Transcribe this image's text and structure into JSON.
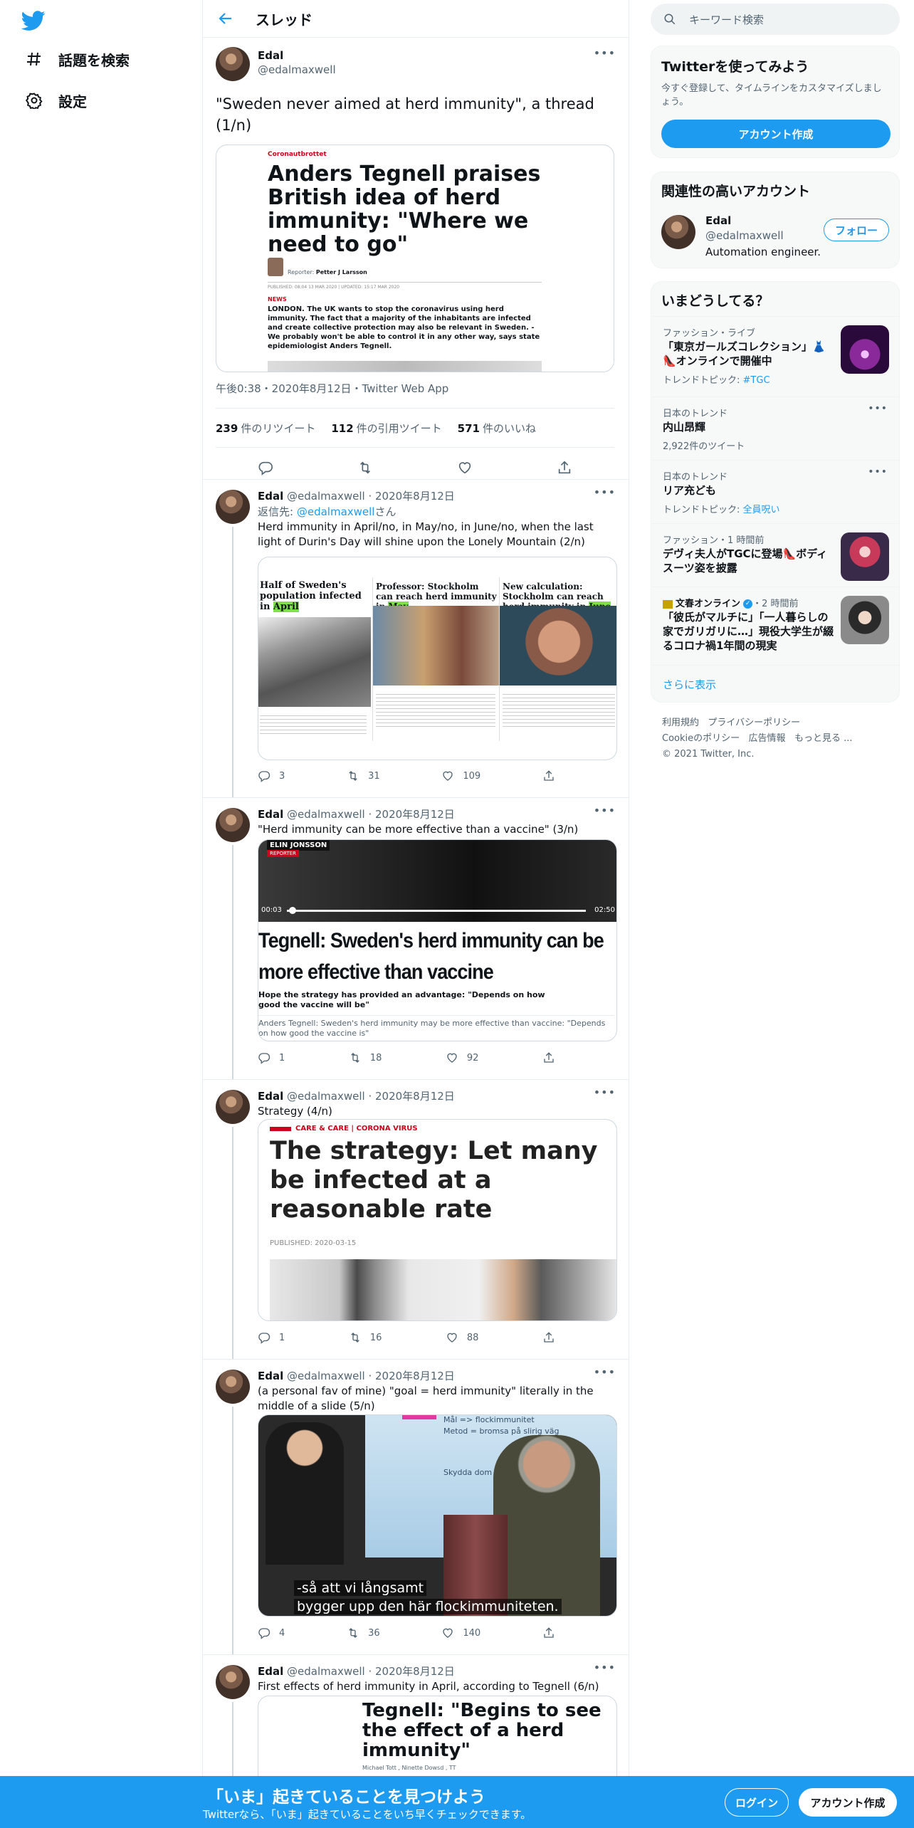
{
  "nav": {
    "explore_label": "話題を検索",
    "settings_label": "設定"
  },
  "header": {
    "title": "スレッド"
  },
  "main_tweet": {
    "name": "Edal",
    "handle": "@edalmaxwell",
    "text": "\"Sweden never aimed at herd immunity\", a thread (1/n)",
    "meta": "午後0:38・2020年8月12日・Twitter Web App",
    "retweets": "239",
    "retweets_label": "件のリツイート",
    "quotes": "112",
    "quotes_label": "件の引用ツイート",
    "likes": "571",
    "likes_label": "件のいいね",
    "card": {
      "kicker": "Coronautbrottet",
      "headline": "Anders Tegnell praises British idea of herd immunity: \"Where we need to go\"",
      "reporter_label": "Reporter:",
      "reporter": "Petter J Larsson",
      "published": "PUBLISHED: 08:04 13 MAR 2020 | UPDATED: 15:17 MAR 2020",
      "news_label": "NEWS",
      "body": "LONDON. The UK wants to stop the coronavirus using herd immunity. The fact that a majority of the inhabitants are infected and create collective protection may also be relevant in Sweden. - We probably won't be able to control it in any other way, says state epidemiologist Anders Tegnell."
    }
  },
  "tweets": [
    {
      "name": "Edal",
      "handle": "@edalmaxwell",
      "date": "2020年8月12日",
      "reply_prefix": "返信先:",
      "reply_to": "@edalmaxwell",
      "reply_suffix": "さん",
      "text": "Herd immunity in April/no, in May/no, in June/no,  when the last light of Durin's Day will shine upon the Lonely Mountain (2/n)",
      "replies": "3",
      "retweets": "31",
      "likes": "109",
      "panel1_title": "Half of Sweden's population infected in",
      "panel1_highlight": "April",
      "panel2_title": "Professor: Stockholm can reach herd immunity in",
      "panel2_highlight": "May",
      "panel3_title": "New calculation: Stockholm can reach herd immunity in",
      "panel3_highlight": "June"
    },
    {
      "name": "Edal",
      "handle": "@edalmaxwell",
      "date": "2020年8月12日",
      "text": "\"Herd immunity can be more effective than a vaccine\" (3/n)",
      "replies": "1",
      "retweets": "18",
      "likes": "92",
      "video_name": "ELIN JONSSON",
      "video_role": "REPORTER",
      "video_time_start": "00:03",
      "video_time_end": "02:50",
      "video_progress": 0.02,
      "headline": "Tegnell: Sweden's herd immunity can be more effective than vaccine",
      "sub": "Hope the strategy has provided an advantage: \"Depends on how good the vaccine will be\"",
      "caption": "Anders Tegnell: Sweden's herd immunity may be more effective than vaccine: \"Depends on how good the vaccine is\""
    },
    {
      "name": "Edal",
      "handle": "@edalmaxwell",
      "date": "2020年8月12日",
      "text": "Strategy  (4/n)",
      "replies": "1",
      "retweets": "16",
      "likes": "88",
      "kicker": "CARE & CARE | CORONA VIRUS",
      "headline": "The strategy: Let many be infected at a reasonable rate",
      "published": "PUBLISHED: 2020-03-15"
    },
    {
      "name": "Edal",
      "handle": "@edalmaxwell",
      "date": "2020年8月12日",
      "text": "(a personal fav of mine) \"goal = herd immunity\" literally in the middle of a slide  (5/n)",
      "replies": "4",
      "retweets": "36",
      "likes": "140",
      "slide_line1": "Mål => flockimmunitet",
      "slide_line2": "Metod = bromsa på slirig väg",
      "slide_line3": "Skydda dom sköra",
      "subtitle1": "-så att vi långsamt",
      "subtitle2": "bygger upp den här flockimmuniteten."
    },
    {
      "name": "Edal",
      "handle": "@edalmaxwell",
      "date": "2020年8月12日",
      "text": "First effects of herd immunity in April, according to Tegnell (6/n)",
      "headline": "Tegnell: \"Begins to see the effect of a herd immunity\"",
      "byline": "Michael Tott , Ninette Dowsd , TT"
    }
  ],
  "sidebar": {
    "search_placeholder": "キーワード検索",
    "signup_panel": {
      "title": "Twitterを使ってみよう",
      "desc": "今すぐ登録して、タイムラインをカスタマイズしましょう。",
      "button": "アカウント作成"
    },
    "related": {
      "title": "関連性の高いアカウント",
      "name": "Edal",
      "handle": "@edalmaxwell",
      "bio": "Automation engineer.",
      "follow": "フォロー"
    },
    "trends": {
      "title": "いまどうしてる？",
      "items": [
        {
          "context": "ファッション・ライブ",
          "title": "「東京ガールズコレクション」👗👠オンラインで開催中",
          "sub_prefix": "トレンドトピック:",
          "sub_link": "#TGC"
        },
        {
          "context": "日本のトレンド",
          "title": "内山昂輝",
          "sub": "2,922件のツイート"
        },
        {
          "context": "日本のトレンド",
          "title": "リア充ども",
          "sub_prefix": "トレンドトピック:",
          "sub_link": "全員呪い"
        },
        {
          "context": "ファッション・1 時間前",
          "title": "デヴィ夫人がTGCに登場👠ボディスーツ姿を披露"
        },
        {
          "context_source": "文春オンライン",
          "context_time": "・2 時間前",
          "title": "「彼氏がマルチに」「一人暮らしの家でガリガリに…」現役大学生が綴るコロナ禍1年間の現実"
        }
      ],
      "show_more": "さらに表示"
    },
    "footer": {
      "terms": "利用規約",
      "privacy": "プライバシーポリシー",
      "cookie": "Cookieのポリシー",
      "ads": "広告情報",
      "more": "もっと見る ...",
      "copyright": "© 2021 Twitter, Inc."
    }
  },
  "bottom_bar": {
    "title": "「いま」起きていることを見つけよう",
    "sub": "Twitterなら、「いま」起きていることをいち早くチェックできます。",
    "login": "ログイン",
    "signup": "アカウント作成"
  },
  "colors": {
    "accent": "#1d9bf0",
    "highlight": "#7ee04a",
    "news_red": "#d0021b"
  }
}
